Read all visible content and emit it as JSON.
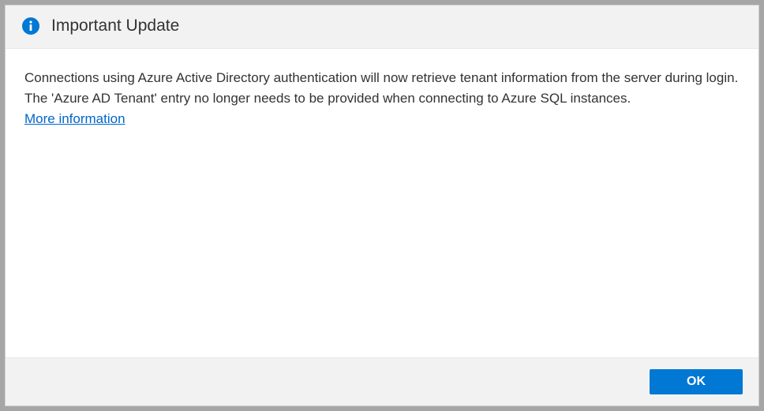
{
  "dialog": {
    "title": "Important Update",
    "message": "Connections using Azure Active Directory authentication will now retrieve tenant information from the server during login. The 'Azure AD Tenant' entry no longer needs to be provided when connecting to Azure SQL instances.",
    "link_label": "More information",
    "ok_label": "OK"
  }
}
